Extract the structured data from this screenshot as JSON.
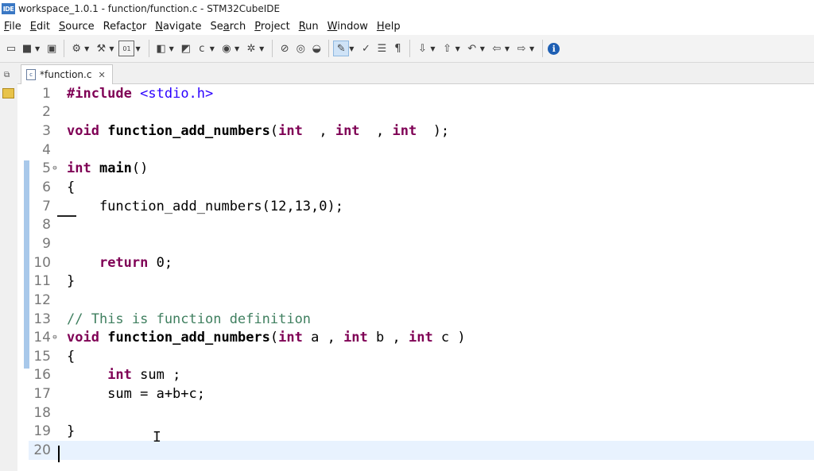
{
  "window": {
    "logo_text": "IDE",
    "title": "workspace_1.0.1 - function/function.c - STM32CubeIDE"
  },
  "menu": [
    {
      "mn": "F",
      "rest": "ile"
    },
    {
      "mn": "E",
      "rest": "dit"
    },
    {
      "mn": "S",
      "rest": "ource"
    },
    {
      "pre": "Refac",
      "mn": "t",
      "rest": "or"
    },
    {
      "mn": "N",
      "rest": "avigate"
    },
    {
      "pre": "Se",
      "mn": "a",
      "rest": "rch"
    },
    {
      "mn": "P",
      "rest": "roject"
    },
    {
      "mn": "R",
      "rest": "un"
    },
    {
      "mn": "W",
      "rest": "indow"
    },
    {
      "mn": "H",
      "rest": "elp"
    }
  ],
  "toolbar_icons": [
    "new-icon",
    "save-icon",
    "save-all-icon",
    "build-settings-icon",
    "build-hammer-icon",
    "binary-icon",
    "new-class-icon",
    "open-type-icon",
    "new-c-file-icon",
    "run-icon",
    "debug-icon",
    "skip-breakpoints-icon",
    "sync-icon",
    "open-perspective-icon",
    "edit-icon",
    "toggle-mark-icon",
    "outline-icon",
    "show-whitespace-icon",
    "next-annotation-icon",
    "prev-annotation-icon",
    "last-edit-icon",
    "back-icon",
    "forward-icon",
    "info-icon"
  ],
  "tab": {
    "label": "*function.c",
    "file_icon_text": "c",
    "close_glyph": "✕"
  },
  "code_lines": [
    {
      "n": "1",
      "parts": [
        {
          "c": "kw",
          "t": "#include"
        },
        {
          "c": "txt",
          "t": " "
        },
        {
          "c": "str",
          "t": "<stdio.h>"
        }
      ]
    },
    {
      "n": "2",
      "parts": []
    },
    {
      "n": "3",
      "parts": [
        {
          "c": "kw",
          "t": "void"
        },
        {
          "c": "txt",
          "t": " "
        },
        {
          "c": "fn",
          "t": "function_add_numbers"
        },
        {
          "c": "txt",
          "t": "("
        },
        {
          "c": "kw",
          "t": "int"
        },
        {
          "c": "txt",
          "t": "  , "
        },
        {
          "c": "kw",
          "t": "int"
        },
        {
          "c": "txt",
          "t": "  , "
        },
        {
          "c": "kw",
          "t": "int"
        },
        {
          "c": "txt",
          "t": "  );"
        }
      ]
    },
    {
      "n": "4",
      "parts": []
    },
    {
      "n": "5",
      "fold": "⊖",
      "parts": [
        {
          "c": "kw",
          "t": "int"
        },
        {
          "c": "txt",
          "t": " "
        },
        {
          "c": "fn",
          "t": "main"
        },
        {
          "c": "txt",
          "t": "()"
        }
      ]
    },
    {
      "n": "6",
      "parts": [
        {
          "c": "txt",
          "t": "{"
        }
      ]
    },
    {
      "n": "7",
      "parts": [
        {
          "c": "txt",
          "t": "    function_add_numbers(12,13,0);"
        }
      ]
    },
    {
      "n": "8",
      "parts": []
    },
    {
      "n": "9",
      "parts": []
    },
    {
      "n": "10",
      "parts": [
        {
          "c": "txt",
          "t": "    "
        },
        {
          "c": "kw",
          "t": "return"
        },
        {
          "c": "txt",
          "t": " 0;"
        }
      ]
    },
    {
      "n": "11",
      "parts": [
        {
          "c": "txt",
          "t": "}"
        }
      ]
    },
    {
      "n": "12",
      "parts": []
    },
    {
      "n": "13",
      "parts": [
        {
          "c": "cmt",
          "t": "// This is function definition"
        }
      ]
    },
    {
      "n": "14",
      "fold": "⊖",
      "parts": [
        {
          "c": "kw",
          "t": "void"
        },
        {
          "c": "txt",
          "t": " "
        },
        {
          "c": "fn",
          "t": "function_add_numbers"
        },
        {
          "c": "txt",
          "t": "("
        },
        {
          "c": "kw",
          "t": "int"
        },
        {
          "c": "txt",
          "t": " a , "
        },
        {
          "c": "kw",
          "t": "int"
        },
        {
          "c": "txt",
          "t": " b , "
        },
        {
          "c": "kw",
          "t": "int"
        },
        {
          "c": "txt",
          "t": " c )"
        }
      ]
    },
    {
      "n": "15",
      "parts": [
        {
          "c": "txt",
          "t": "{"
        }
      ]
    },
    {
      "n": "16",
      "parts": [
        {
          "c": "txt",
          "t": "     "
        },
        {
          "c": "kw",
          "t": "int"
        },
        {
          "c": "txt",
          "t": " sum ;"
        }
      ]
    },
    {
      "n": "17",
      "parts": [
        {
          "c": "txt",
          "t": "     sum = a+b+c;"
        }
      ]
    },
    {
      "n": "18",
      "parts": []
    },
    {
      "n": "19",
      "parts": [
        {
          "c": "txt",
          "t": "}"
        }
      ]
    },
    {
      "n": "20",
      "current": true,
      "parts": []
    }
  ],
  "colors": {
    "keyword": "#7f0055",
    "string": "#2a00ff",
    "comment": "#3f7f5f",
    "current_line": "#e8f2fe",
    "change_ruler": "#a8c8ea"
  }
}
